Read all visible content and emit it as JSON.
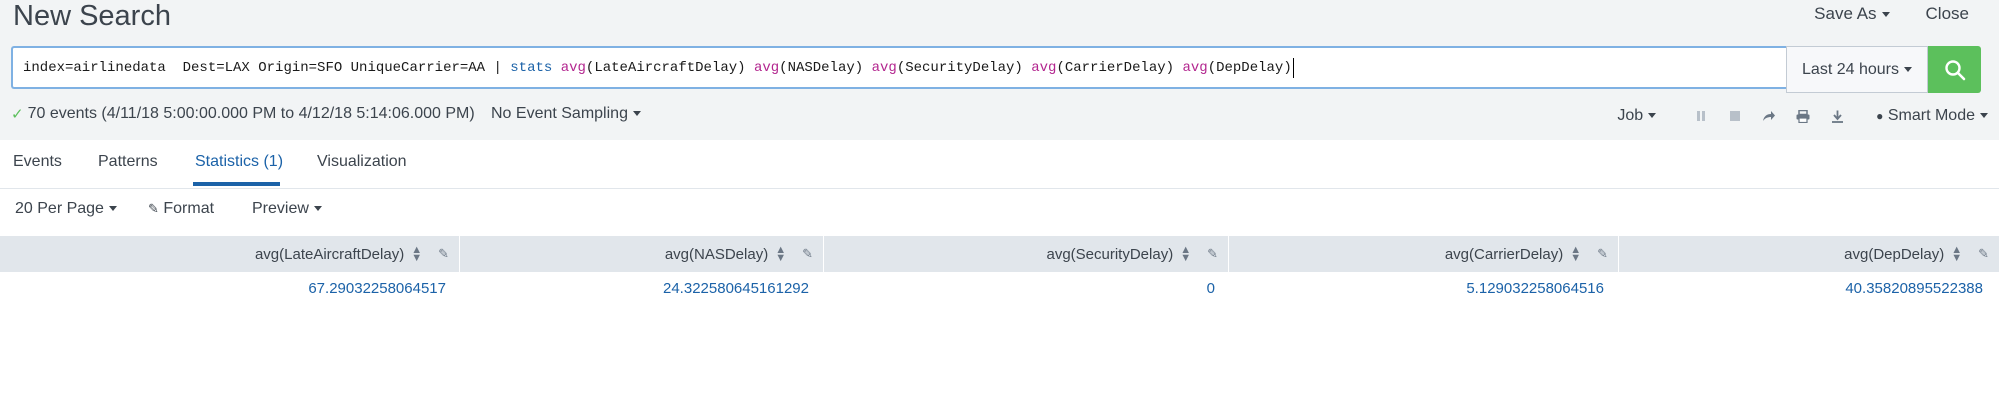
{
  "page": {
    "title": "New Search"
  },
  "top_actions": {
    "save_as": "Save As",
    "close": "Close"
  },
  "search": {
    "query_prefix": "index=airlinedata  Dest=LAX Origin=SFO UniqueCarrier=AA | ",
    "query_cmd": "stats",
    "query_parts": [
      {
        "fn": "avg",
        "arg": "(LateAircraftDelay) "
      },
      {
        "fn": "avg",
        "arg": "(NASDelay) "
      },
      {
        "fn": "avg",
        "arg": "(SecurityDelay) "
      },
      {
        "fn": "avg",
        "arg": "(CarrierDelay) "
      },
      {
        "fn": "avg",
        "arg": "(DepDelay)"
      }
    ],
    "time_range": "Last 24 hours"
  },
  "status": {
    "events_text": "70 events (4/11/18 5:00:00.000 PM to 4/12/18 5:14:06.000 PM)",
    "sampling": "No Event Sampling",
    "job": "Job",
    "mode": "Smart Mode"
  },
  "tabs": [
    {
      "label": "Events"
    },
    {
      "label": "Patterns"
    },
    {
      "label": "Statistics (1)"
    },
    {
      "label": "Visualization"
    }
  ],
  "options": {
    "per_page": "20 Per Page",
    "format": "Format",
    "preview": "Preview"
  },
  "table": {
    "columns": [
      "avg(LateAircraftDelay)",
      "avg(NASDelay)",
      "avg(SecurityDelay)",
      "avg(CarrierDelay)",
      "avg(DepDelay)"
    ],
    "rows": [
      [
        "67.29032258064517",
        "24.322580645161292",
        "0",
        "5.129032258064516",
        "40.35820895522388"
      ]
    ]
  },
  "colors": {
    "accent": "#1b62a8",
    "search_button": "#5cc05c",
    "function": "#b3268f"
  }
}
